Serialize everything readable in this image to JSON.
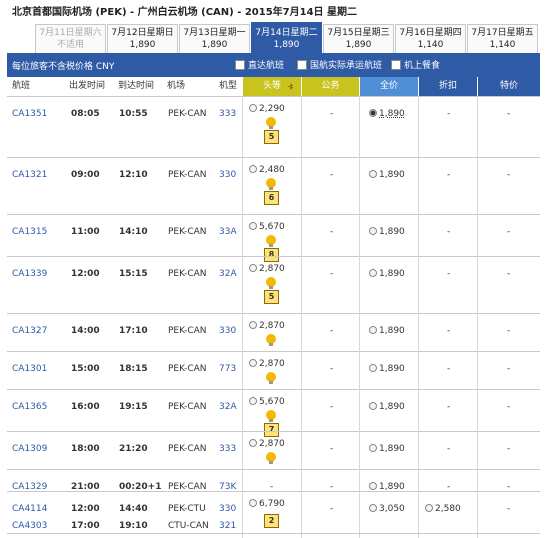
{
  "route": "北京首都国际机场 (PEK) - 广州白云机场 (CAN) - 2015年7月14日 星期二",
  "date_tabs": [
    {
      "label": "7月11日星期六",
      "price": "不适用",
      "state": "disabled"
    },
    {
      "label": "7月12日星期日",
      "price": "1,890",
      "state": "normal"
    },
    {
      "label": "7月13日星期一",
      "price": "1,890",
      "state": "normal"
    },
    {
      "label": "7月14日星期二",
      "price": "1,890",
      "state": "active"
    },
    {
      "label": "7月15日星期三",
      "price": "1,890",
      "state": "normal"
    },
    {
      "label": "7月16日星期四",
      "price": "1,140",
      "state": "normal"
    },
    {
      "label": "7月17日星期五",
      "price": "1,140",
      "state": "normal"
    }
  ],
  "bar": {
    "title": "每位旅客不含税价格 CNY",
    "filters": [
      "直达航班",
      "国航实际承运航班",
      "机上餐食"
    ]
  },
  "headers": {
    "flight": "航班",
    "depart": "出发时间",
    "arrive": "到达时间",
    "airport": "机场",
    "aircraft": "机型",
    "fares": [
      "头等",
      "公务",
      "全价",
      "折扣",
      "特价"
    ]
  },
  "colors": {
    "brand": "#2f5aa6",
    "first": "#c9c31f",
    "business": "#c9c31f",
    "full": "#4e8fd6",
    "discount": "#2f5aa6",
    "special": "#2f5aa6",
    "selected_row": "#d9e7fb",
    "seat_badge": "#ffe37a",
    "bulb": "#f5b800"
  },
  "icons": {
    "bulb": "light-bulb-icon",
    "seat": "seat-count-badge",
    "sort": "sort-arrows-icon"
  },
  "flights": [
    {
      "flight": "CA1351",
      "dep": "08:05",
      "arr": "10:55",
      "airport": "PEK-CAN",
      "type": "333",
      "first": "2,290",
      "business": "-",
      "full": "1,890",
      "discount": "-",
      "special": "-",
      "bulb": true,
      "seats": "5",
      "selected": true
    },
    {
      "flight": "CA1321",
      "dep": "09:00",
      "arr": "12:10",
      "airport": "PEK-CAN",
      "type": "330",
      "first": "2,480",
      "business": "-",
      "full": "1,890",
      "discount": "-",
      "special": "-",
      "bulb": true,
      "seats": "6",
      "selected": false
    },
    {
      "flight": "CA1315",
      "dep": "11:00",
      "arr": "14:10",
      "airport": "PEK-CAN",
      "type": "33A",
      "first": "5,670",
      "business": "-",
      "full": "1,890",
      "discount": "-",
      "special": "-",
      "bulb": true,
      "seats": "8",
      "selected": false
    },
    {
      "flight": "CA1339",
      "dep": "12:00",
      "arr": "15:15",
      "airport": "PEK-CAN",
      "type": "32A",
      "first": "2,870",
      "business": "-",
      "full": "1,890",
      "discount": "-",
      "special": "-",
      "bulb": true,
      "seats": "5",
      "selected": false
    },
    {
      "flight": "CA1327",
      "dep": "14:00",
      "arr": "17:10",
      "airport": "PEK-CAN",
      "type": "330",
      "first": "2,870",
      "business": "-",
      "full": "1,890",
      "discount": "-",
      "special": "-",
      "bulb": true,
      "seats": "",
      "selected": false
    },
    {
      "flight": "CA1301",
      "dep": "15:00",
      "arr": "18:15",
      "airport": "PEK-CAN",
      "type": "773",
      "first": "2,870",
      "business": "-",
      "full": "1,890",
      "discount": "-",
      "special": "-",
      "bulb": true,
      "seats": "",
      "selected": false
    },
    {
      "flight": "CA1365",
      "dep": "16:00",
      "arr": "19:15",
      "airport": "PEK-CAN",
      "type": "32A",
      "first": "5,670",
      "business": "-",
      "full": "1,890",
      "discount": "-",
      "special": "-",
      "bulb": true,
      "seats": "7",
      "selected": false
    },
    {
      "flight": "CA1309",
      "dep": "18:00",
      "arr": "21:20",
      "airport": "PEK-CAN",
      "type": "333",
      "first": "2,870",
      "business": "-",
      "full": "1,890",
      "discount": "-",
      "special": "-",
      "bulb": true,
      "seats": "",
      "selected": false
    },
    {
      "flight": "CA1329",
      "dep": "21:00",
      "arr": "00:20+1",
      "airport": "PEK-CAN",
      "type": "73K",
      "first": "-",
      "business": "-",
      "full": "1,890",
      "discount": "-",
      "special": "-",
      "bulb": false,
      "seats": "",
      "selected": false
    },
    {
      "flight": "CA4114",
      "dep": "12:00",
      "arr": "14:40",
      "airport": "PEK-CTU",
      "type": "330",
      "first": "6,790",
      "business": "-",
      "full": "3,050",
      "discount": "2,580",
      "special": "-",
      "bulb": false,
      "seats": "2",
      "selected": false,
      "second": {
        "flight": "CA4303",
        "dep": "17:00",
        "arr": "19:10",
        "airport": "CTU-CAN",
        "type": "321"
      }
    }
  ]
}
